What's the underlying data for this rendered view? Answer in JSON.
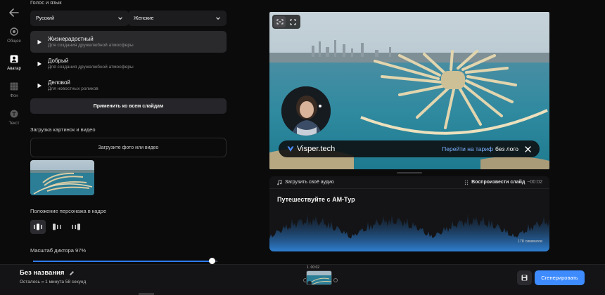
{
  "rail": {
    "items": [
      {
        "label": "Общее",
        "icon": "circle-settings-icon"
      },
      {
        "label": "Аватар",
        "icon": "avatar-icon",
        "active": true
      },
      {
        "label": "Фон",
        "icon": "background-icon"
      },
      {
        "label": "Текст",
        "icon": "text-icon"
      }
    ]
  },
  "panel": {
    "voice_section_title": "Голос и язык",
    "language_select": "Русский",
    "gender_select": "Женские",
    "voices": [
      {
        "name": "Жизнерадостный",
        "desc": "Для создания дружелюбной атмосферы",
        "active": true
      },
      {
        "name": "Добрый",
        "desc": "Для создания дружелюбной атмосферы"
      },
      {
        "name": "Деловой",
        "desc": "Для новостных роликов"
      }
    ],
    "apply_button": "Применить ко всем слайдам",
    "upload_section_title": "Загрузка картинок и видео",
    "upload_button": "Загрузите фото или видео",
    "position_section_title": "Положение персонажа в кадре",
    "scale_label": "Масштаб диктора 97%",
    "scale_value": 97
  },
  "preview": {
    "brand_name": "Visper.tech",
    "brand_link": "Перейти на тариф",
    "brand_suffix": "без лого"
  },
  "script": {
    "upload_audio": "Загрузить своё аудио",
    "play_slide": "Воспроизвести слайд",
    "play_time": "~00:02",
    "text": "Путешествуйте с АМ-Тур",
    "char_count": "178 символов"
  },
  "bottom": {
    "project_title": "Без названия",
    "remaining": "Осталось » 1 минута 58 секунд",
    "timeline_time": "1. 00:02",
    "generate_button": "Сгенерировать"
  },
  "colors": {
    "accent": "#3d8bff",
    "link": "#7cb0ff",
    "background": "#0b0b0c",
    "surface": "#1c1c1f"
  }
}
